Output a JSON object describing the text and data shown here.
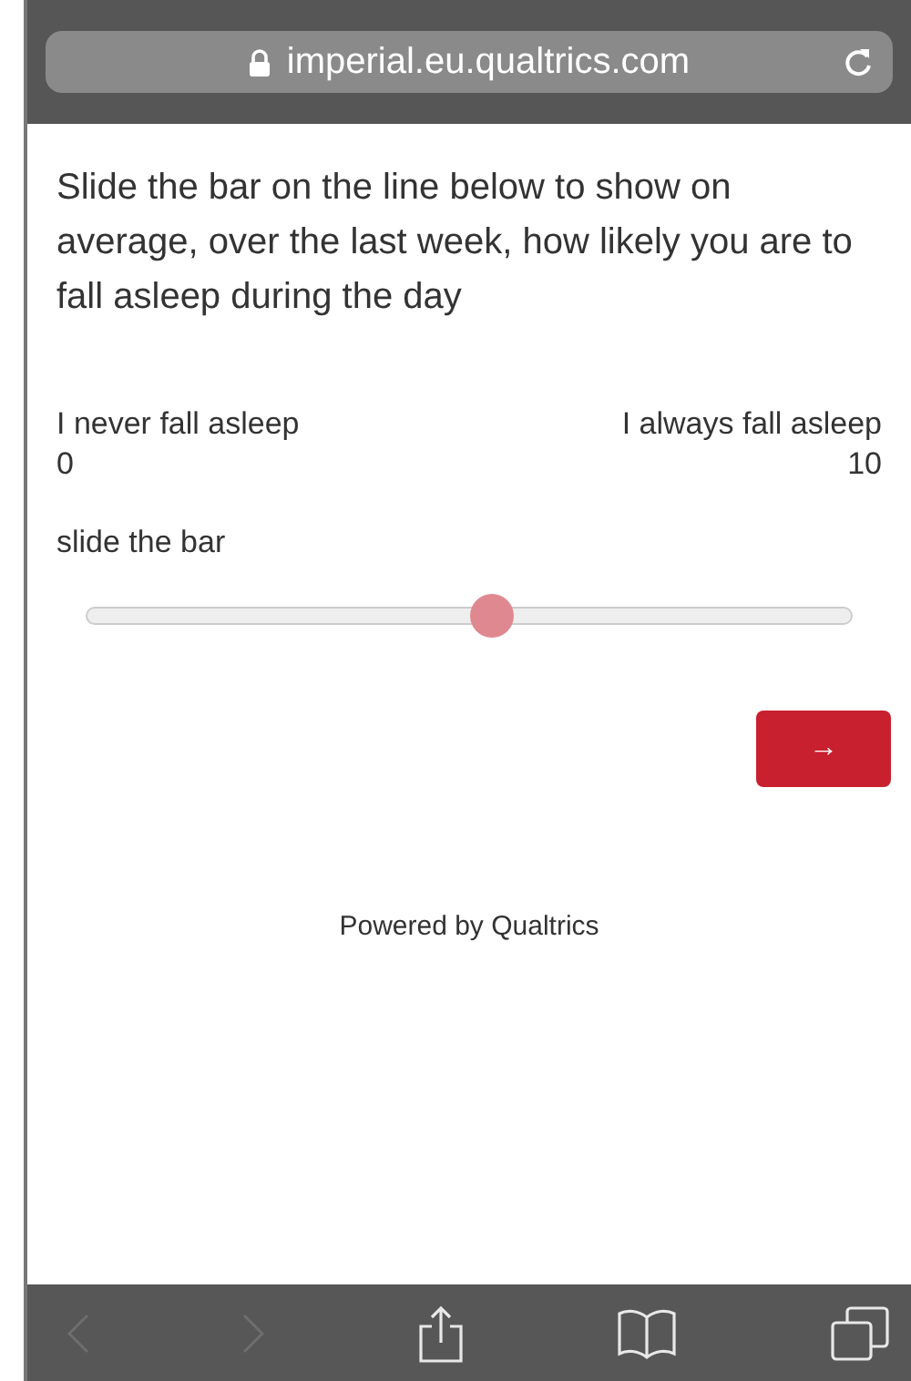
{
  "browser": {
    "url": "imperial.eu.qualtrics.com"
  },
  "question": {
    "text": "Slide the bar on the line below to show on average, over the last week, how likely you are to fall asleep during the day",
    "left_label": "I never fall asleep",
    "right_label": "I always fall asleep",
    "min": "0",
    "max": "10",
    "slider_label": "slide the bar",
    "slider": {
      "level": 0.53
    }
  },
  "next_button": "→",
  "footer": "Powered by Qualtrics",
  "toolbar": {
    "back": {
      "disabled": true
    },
    "forward": {
      "disabled": true
    }
  }
}
